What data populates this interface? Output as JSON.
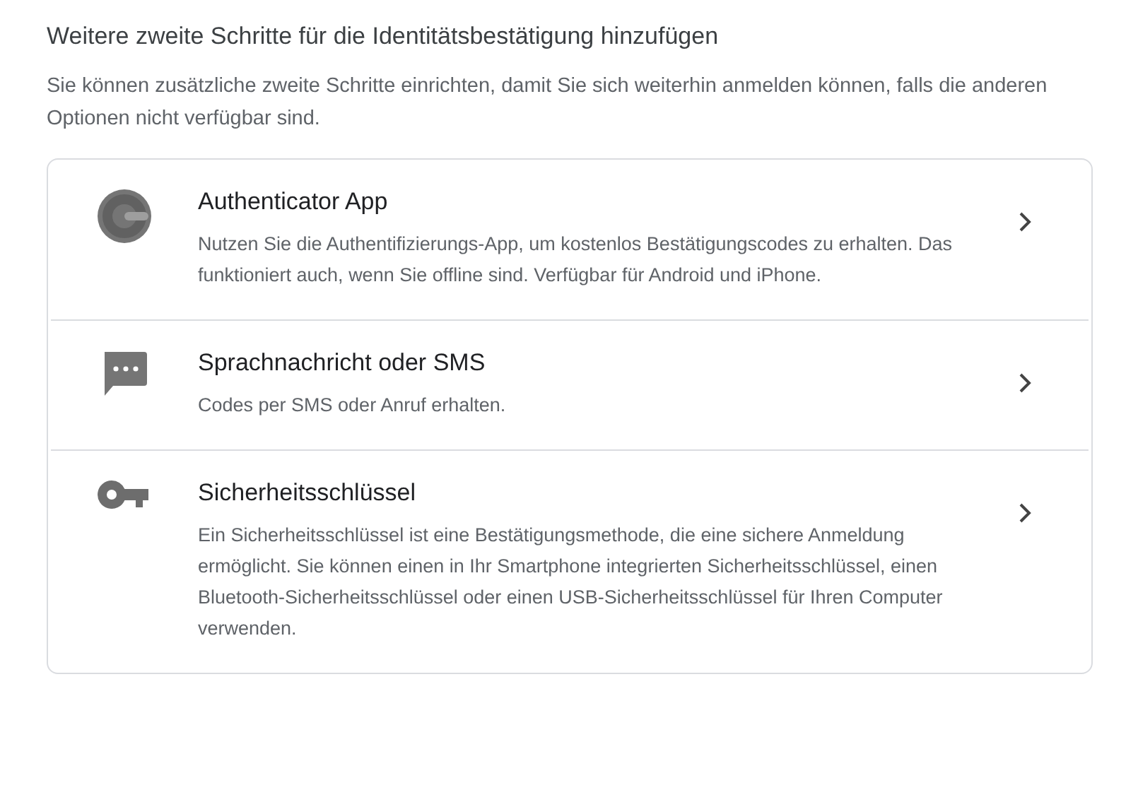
{
  "heading": "Weitere zweite Schritte für die Identitätsbestätigung hinzufügen",
  "intro": "Sie können zusätzliche zweite Schritte einrichten, damit Sie sich weiterhin anmelden können, falls die anderen Optionen nicht verfügbar sind.",
  "options": [
    {
      "kind": "authenticator",
      "title": "Authenticator App",
      "description": "Nutzen Sie die Authentifizierungs-App, um kostenlos Bestätigungscodes zu erhalten. Das funktioniert auch, wenn Sie offline sind. Verfügbar für Android und iPhone."
    },
    {
      "kind": "sms",
      "title": "Sprachnachricht oder SMS",
      "description": "Codes per SMS oder Anruf erhalten."
    },
    {
      "kind": "key",
      "title": "Sicherheitsschlüssel",
      "description": "Ein Sicherheitsschlüssel ist eine Bestätigungsmethode, die eine sichere Anmeldung ermöglicht. Sie können einen in Ihr Smartphone integrierten Sicherheitsschlüssel, einen Bluetooth-Sicherheitsschlüssel oder einen USB-Sicherheitsschlüssel für Ihren Computer verwenden."
    }
  ]
}
